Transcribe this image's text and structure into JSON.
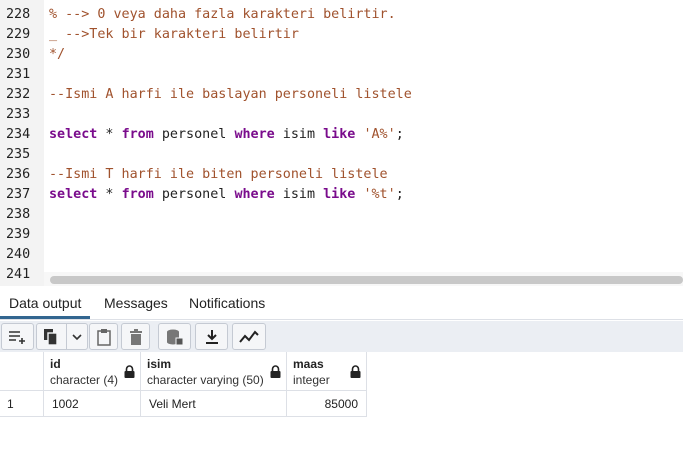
{
  "editor": {
    "lines": [
      {
        "num": "228",
        "segments": [
          {
            "t": "% --> 0 veya daha fazla karakteri belirtir.",
            "c": "cm"
          }
        ]
      },
      {
        "num": "229",
        "segments": [
          {
            "t": "_ -->Tek bir karakteri belirtir",
            "c": "cm"
          }
        ]
      },
      {
        "num": "230",
        "segments": [
          {
            "t": "*/",
            "c": "cm"
          }
        ]
      },
      {
        "num": "231",
        "segments": []
      },
      {
        "num": "232",
        "segments": [
          {
            "t": "--Ismi A harfi ile baslayan personeli listele",
            "c": "cm"
          }
        ]
      },
      {
        "num": "233",
        "segments": []
      },
      {
        "num": "234",
        "segments": [
          {
            "t": "select",
            "c": "kw"
          },
          {
            "t": " * ",
            "c": "plain"
          },
          {
            "t": "from",
            "c": "kw"
          },
          {
            "t": " personel ",
            "c": "plain"
          },
          {
            "t": "where",
            "c": "kw"
          },
          {
            "t": " isim ",
            "c": "plain"
          },
          {
            "t": "like",
            "c": "kw"
          },
          {
            "t": " ",
            "c": "plain"
          },
          {
            "t": "'A%'",
            "c": "str"
          },
          {
            "t": ";",
            "c": "plain"
          }
        ]
      },
      {
        "num": "235",
        "segments": []
      },
      {
        "num": "236",
        "segments": [
          {
            "t": "--Ismi T harfi ile biten personeli listele",
            "c": "cm"
          }
        ]
      },
      {
        "num": "237",
        "segments": [
          {
            "t": "select",
            "c": "kw"
          },
          {
            "t": " * ",
            "c": "plain"
          },
          {
            "t": "from",
            "c": "kw"
          },
          {
            "t": " personel ",
            "c": "plain"
          },
          {
            "t": "where",
            "c": "kw"
          },
          {
            "t": " isim ",
            "c": "plain"
          },
          {
            "t": "like",
            "c": "kw"
          },
          {
            "t": " ",
            "c": "plain"
          },
          {
            "t": "'%t'",
            "c": "str"
          },
          {
            "t": ";",
            "c": "plain"
          }
        ]
      },
      {
        "num": "238",
        "segments": []
      },
      {
        "num": "239",
        "segments": []
      },
      {
        "num": "240",
        "segments": []
      },
      {
        "num": "241",
        "segments": []
      }
    ]
  },
  "tabs": [
    {
      "label": "Data output",
      "active": true
    },
    {
      "label": "Messages",
      "active": false
    },
    {
      "label": "Notifications",
      "active": false
    }
  ],
  "toolbar": {
    "icons": [
      "add-row-icon",
      "copy-icon",
      "dropdown-chevron-icon",
      "paste-icon",
      "delete-icon",
      "save-data-icon",
      "download-icon",
      "graph-icon"
    ]
  },
  "grid": {
    "columns": [
      {
        "name": "id",
        "type": "character (4)"
      },
      {
        "name": "isim",
        "type": "character varying (50)"
      },
      {
        "name": "maas",
        "type": "integer"
      }
    ],
    "rows": [
      {
        "num": "1",
        "cells": [
          "1002",
          "Veli Mert",
          "85000"
        ]
      }
    ]
  },
  "colors": {
    "comment": "#a0522d",
    "keyword": "#7a0c8c",
    "active_tab_underline": "#326690",
    "toolbar_bg": "#ebeef3"
  }
}
